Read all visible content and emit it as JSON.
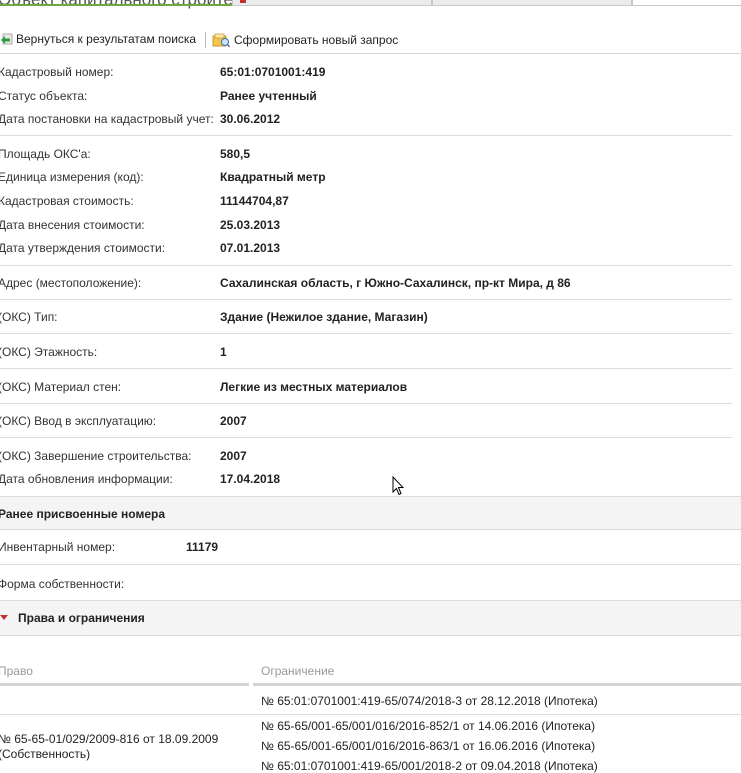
{
  "page": {
    "title": "Объект капитального строительства"
  },
  "toolbar": {
    "back_label": "Вернуться к результатам поиска",
    "new_query_label": "Сформировать новый запрос"
  },
  "fields": {
    "cadastral_number": {
      "label": "Кадастровый номер:",
      "value": "65:01:0701001:419"
    },
    "status": {
      "label": "Статус объекта:",
      "value": "Ранее учтенный"
    },
    "registration_date": {
      "label": "Дата постановки на кадастровый учет:",
      "value": "30.06.2012"
    },
    "area": {
      "label": "Площадь ОКС'а:",
      "value": "580,5"
    },
    "unit": {
      "label": "Единица измерения (код):",
      "value": "Квадратный метр"
    },
    "cadastral_cost": {
      "label": "Кадастровая стоимость:",
      "value": "11144704,87"
    },
    "cost_entry_date": {
      "label": "Дата внесения стоимости:",
      "value": "25.03.2013"
    },
    "cost_approval_date": {
      "label": "Дата утверждения стоимости:",
      "value": "07.01.2013"
    },
    "address": {
      "label": "Адрес (местоположение):",
      "value": "Сахалинская область, г Южно-Сахалинск, пр-кт Мира, д 86"
    },
    "type": {
      "label": "(ОКС) Тип:",
      "value": "Здание (Нежилое здание, Магазин)"
    },
    "floors": {
      "label": "(ОКС) Этажность:",
      "value": "1"
    },
    "wall_material": {
      "label": "(ОКС) Материал стен:",
      "value": "Легкие из местных материалов"
    },
    "commissioning": {
      "label": "(ОКС) Ввод в эксплуатацию:",
      "value": "2007"
    },
    "construction_end": {
      "label": "(ОКС) Завершение строительства:",
      "value": "2007"
    },
    "info_update_date": {
      "label": "Дата обновления информации:",
      "value": "17.04.2018"
    }
  },
  "previous_numbers": {
    "header": "Ранее присвоенные номера",
    "inventory_label": "Инвентарный номер:",
    "inventory_value": "11179"
  },
  "ownership": {
    "label": "Форма собственности:",
    "value": ""
  },
  "rights": {
    "header": "Права и ограничения",
    "columns": {
      "right": "Право",
      "restriction": "Ограничение"
    },
    "rows": [
      {
        "right_line1": "",
        "right_line2": "",
        "restrictions": [
          "№ 65:01:0701001:419-65/074/2018-3  от 28.12.2018  (Ипотека)"
        ]
      },
      {
        "right_line1": "№ 65-65-01/029/2009-816  от 18.09.2009",
        "right_line2": "(Собственность)",
        "restrictions": [
          "№ 65-65/001-65/001/016/2016-852/1  от 14.06.2016  (Ипотека)",
          "№ 65-65/001-65/001/016/2016-863/1  от 16.06.2016  (Ипотека)",
          "№ 65:01:0701001:419-65/001/2018-2  от 09.04.2018  (Ипотека)"
        ]
      }
    ]
  },
  "colors": {
    "accent": "#6fa83a",
    "triangle": "#c0302f"
  }
}
